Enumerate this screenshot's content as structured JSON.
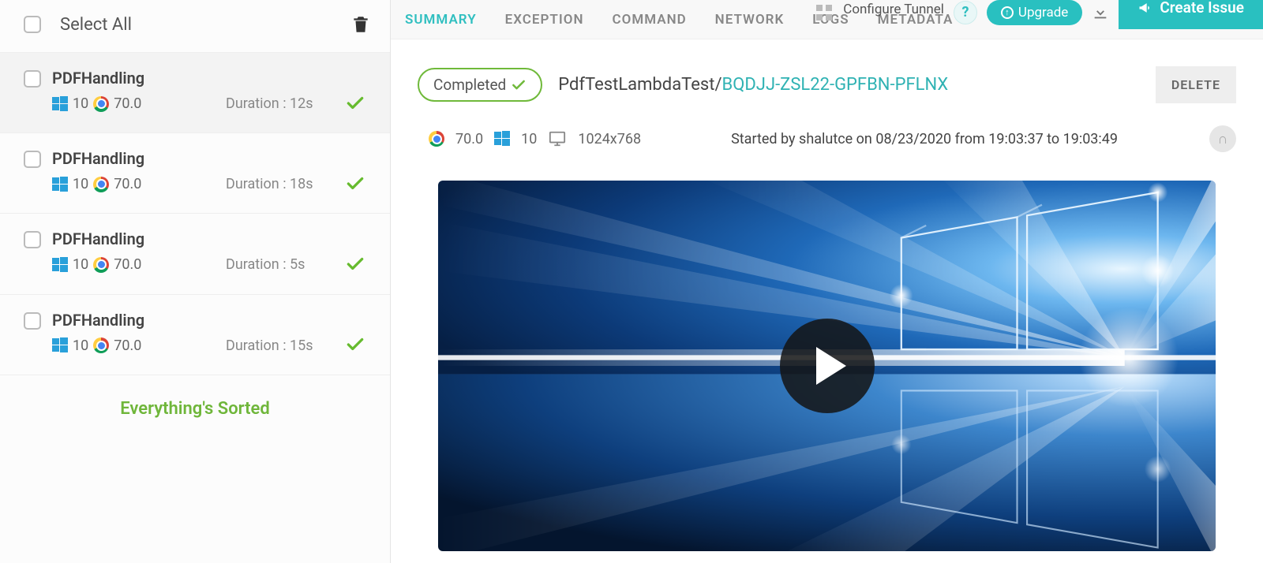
{
  "sidebar": {
    "select_all": "Select All",
    "sorted_msg": "Everything's Sorted",
    "items": [
      {
        "title": "PDFHandling",
        "os_ver": "10",
        "browser_ver": "70.0",
        "duration": "Duration : 12s"
      },
      {
        "title": "PDFHandling",
        "os_ver": "10",
        "browser_ver": "70.0",
        "duration": "Duration : 18s"
      },
      {
        "title": "PDFHandling",
        "os_ver": "10",
        "browser_ver": "70.0",
        "duration": "Duration : 5s"
      },
      {
        "title": "PDFHandling",
        "os_ver": "10",
        "browser_ver": "70.0",
        "duration": "Duration : 15s"
      }
    ]
  },
  "tabs": {
    "summary": "SUMMARY",
    "exception": "EXCEPTION",
    "command": "COMMAND",
    "network": "NETWORK",
    "logs": "LOGS",
    "metadata": "METADATA"
  },
  "header": {
    "configure_tunnel": "Configure Tunnel",
    "upgrade": "Upgrade",
    "create_issue": "Create Issue"
  },
  "detail": {
    "status": "Completed",
    "test_name": "PdfTestLambdaTest/",
    "test_id": "BQDJJ-ZSL22-GPFBN-PFLNX",
    "delete": "DELETE",
    "browser_ver": "70.0",
    "os_ver": "10",
    "resolution": "1024x768",
    "started_by": "Started by shalutce on 08/23/2020 from 19:03:37 to 19:03:49"
  }
}
